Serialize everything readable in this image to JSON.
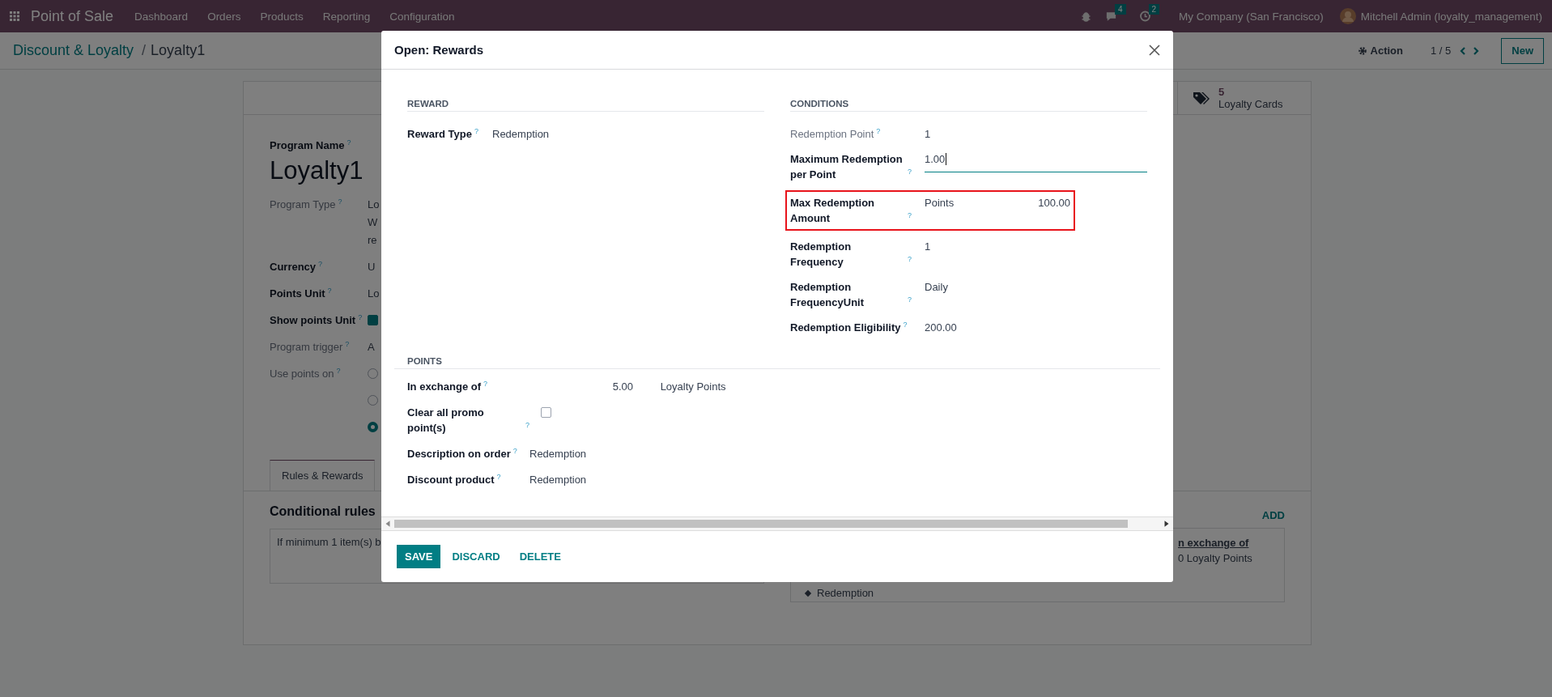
{
  "navbar": {
    "app_name": "Point of Sale",
    "menu": [
      "Dashboard",
      "Orders",
      "Products",
      "Reporting",
      "Configuration"
    ],
    "chat_badge": "4",
    "activity_badge": "2",
    "company": "My Company (San Francisco)",
    "user": "Mitchell Admin (loyalty_management)"
  },
  "control_panel": {
    "breadcrumbs": [
      "Discount & Loyalty",
      "Loyalty1"
    ],
    "separator": "/",
    "action": "Action",
    "pager": "1 / 5",
    "new_button": "New"
  },
  "form": {
    "stat_button": {
      "count": "5",
      "label": "Loyalty Cards"
    },
    "program_name_label": "Program Name",
    "program_name_help": "?",
    "program_name": "Loyalty1",
    "fields": [
      {
        "label": "Program Type",
        "help": "?",
        "muted": true,
        "kind": "text",
        "lines": [
          "Lo",
          "W",
          "re"
        ]
      },
      {
        "label": "Currency",
        "help": "?",
        "muted": false,
        "kind": "text",
        "lines": [
          "U"
        ]
      },
      {
        "label": "Points Unit",
        "help": "?",
        "muted": false,
        "kind": "text",
        "lines": [
          "Lo"
        ]
      },
      {
        "label": "Show points Unit",
        "help": "?",
        "muted": false,
        "kind": "checkbox",
        "checked": true
      },
      {
        "label": "Program trigger",
        "help": "?",
        "muted": true,
        "kind": "text",
        "lines": [
          "A"
        ]
      },
      {
        "label": "Use points on",
        "help": "?",
        "muted": true,
        "kind": "radio",
        "options": [
          {
            "selected": false
          },
          {
            "selected": false
          },
          {
            "selected": true
          }
        ]
      }
    ],
    "tabs": [
      {
        "label": "Rules & Rewards",
        "selected": true
      }
    ],
    "rules_title": "Conditional rules",
    "rule_text": "If minimum 1 item(s) b",
    "rewards": {
      "add": "ADD",
      "link": "n exchange of",
      "points": "0 Loyalty Points",
      "reward": "Redemption"
    }
  },
  "dialog": {
    "title": "Open: Rewards",
    "reward": {
      "title": "REWARD",
      "fields": [
        {
          "label": "Reward Type",
          "help": "?",
          "muted": false,
          "kind": "text",
          "value": "Redemption"
        }
      ]
    },
    "conditions": {
      "title": "CONDITIONS",
      "fields": [
        {
          "label": "Redemption Point",
          "help": "?",
          "muted": true,
          "kind": "text",
          "value": "1"
        },
        {
          "label": "Maximum Redemption per Point",
          "help": "?",
          "muted": false,
          "kind": "input",
          "value": "1.00"
        },
        {
          "label": "Max Redemption Amount",
          "help": "?",
          "muted": false,
          "kind": "amount",
          "unit": "Points",
          "value": "100.00",
          "highlighted": true
        },
        {
          "label": "Redemption Frequency",
          "help": "?",
          "muted": false,
          "kind": "text",
          "value": "1"
        },
        {
          "label": "Redemption FrequencyUnit",
          "help": "?",
          "muted": false,
          "kind": "text",
          "value": "Daily"
        },
        {
          "label": "Redemption Eligibility",
          "help": "?",
          "muted": false,
          "kind": "text",
          "value": "200.00"
        }
      ]
    },
    "points": {
      "title": "POINTS",
      "fields": [
        {
          "label": "In exchange of",
          "help": "?",
          "muted": false,
          "kind": "amount",
          "value": "5.00",
          "unit": "Loyalty Points"
        },
        {
          "label": "Clear all promo point(s)",
          "help": "?",
          "muted": false,
          "kind": "checkbox",
          "checked": false
        },
        {
          "label": "Description on order",
          "help": "?",
          "muted": false,
          "kind": "text",
          "value": "Redemption"
        },
        {
          "label": "Discount product",
          "help": "?",
          "muted": false,
          "kind": "text",
          "value": "Redemption"
        }
      ]
    },
    "buttons": [
      {
        "label": "SAVE",
        "primary": true
      },
      {
        "label": "DISCARD",
        "primary": false
      },
      {
        "label": "DELETE",
        "primary": false
      }
    ]
  }
}
